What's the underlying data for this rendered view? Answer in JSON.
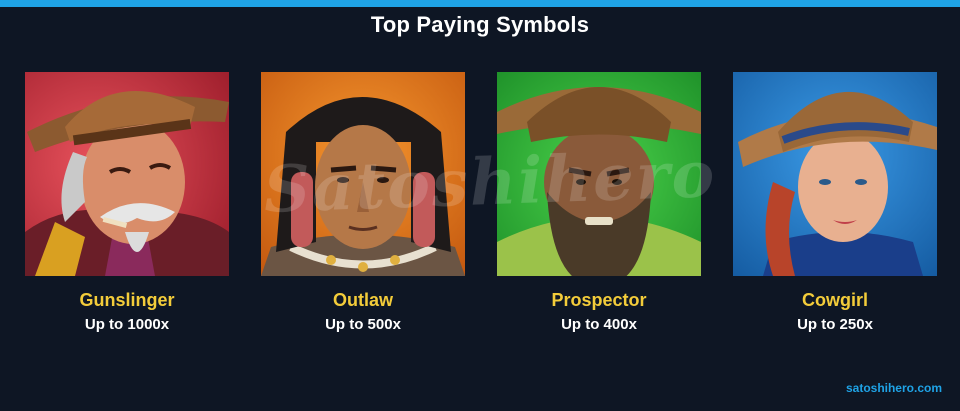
{
  "header": {
    "title": "Top Paying Symbols",
    "accent_color": "#1fa3e6"
  },
  "symbols": [
    {
      "name": "Gunslinger",
      "payout": "Up to 1000x",
      "bg_color": "#c8323c",
      "icon": "gunslinger-portrait"
    },
    {
      "name": "Outlaw",
      "payout": "Up to 500x",
      "bg_color": "#e8731c",
      "icon": "outlaw-portrait"
    },
    {
      "name": "Prospector",
      "payout": "Up to 400x",
      "bg_color": "#2fb53c",
      "icon": "prospector-portrait"
    },
    {
      "name": "Cowgirl",
      "payout": "Up to 250x",
      "bg_color": "#1e7fd0",
      "icon": "cowgirl-portrait"
    }
  ],
  "watermark": {
    "text": "Satoshihero"
  },
  "footer": {
    "site_link": "satoshihero.com"
  },
  "colors": {
    "name_text": "#f3cc3a",
    "payout_text": "#ffffff",
    "background": "#0e1624"
  }
}
